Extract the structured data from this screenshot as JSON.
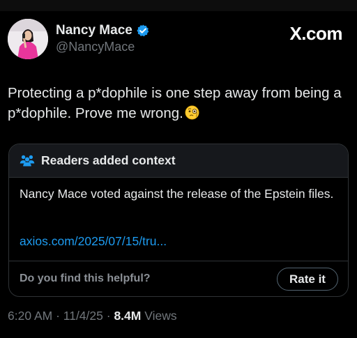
{
  "author": {
    "display_name": "Nancy Mace",
    "handle": "@NancyMace",
    "verified": true,
    "verified_color": "#1d9bf0",
    "avatar_icon": "profile-photo"
  },
  "brand": {
    "label": "X.com"
  },
  "tweet": {
    "text": "Protecting a p*dophile is one step away from being a p*dophile. Prove me wrong.",
    "emoji": "face-with-monocle-emoji"
  },
  "community_note": {
    "icon": "people-icon",
    "title": "Readers added context",
    "body": "Nancy Mace voted against the release of the Epstein files.",
    "link": "axios.com/2025/07/15/tru...",
    "helpful_question": "Do you find this helpful?",
    "rate_button": "Rate it"
  },
  "meta": {
    "time": "6:20 AM",
    "separator": " · ",
    "date": "11/4/25",
    "views_count": "8.4M",
    "views_label": "Views"
  },
  "colors": {
    "background": "#000000",
    "text_primary": "#e7e9ea",
    "text_secondary": "#71767b",
    "link": "#1d9bf0",
    "border": "#2f3336",
    "note_header_bg": "#16181c"
  }
}
